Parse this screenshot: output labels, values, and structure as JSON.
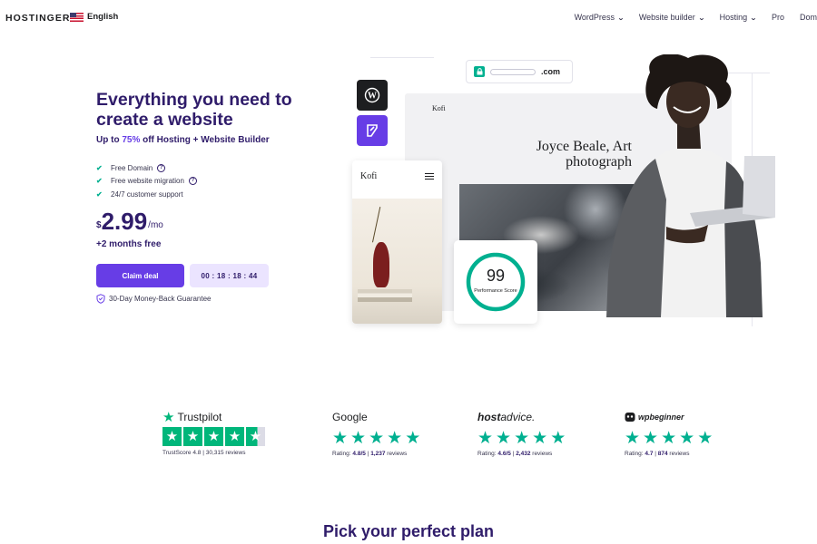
{
  "header": {
    "logo": "HOSTINGER",
    "language": "English",
    "nav": [
      {
        "label": "WordPress",
        "has_dropdown": true
      },
      {
        "label": "Website builder",
        "has_dropdown": true
      },
      {
        "label": "Hosting",
        "has_dropdown": true
      },
      {
        "label": "Pro",
        "has_dropdown": false
      },
      {
        "label": "Dom",
        "has_dropdown": false
      }
    ]
  },
  "hero": {
    "title": "Everything you need to create a website",
    "subtitle_prefix": "Up to ",
    "subtitle_discount": "75%",
    "subtitle_suffix": " off Hosting + Website Builder",
    "features": [
      {
        "label": "Free Domain",
        "help": true
      },
      {
        "label": "Free website migration",
        "help": true
      },
      {
        "label": "24/7 customer support",
        "help": false
      }
    ],
    "price": {
      "currency": "$",
      "amount": "2.99",
      "period": "/mo"
    },
    "bonus": "+2 months free",
    "cta_label": "Claim deal",
    "timer": "00 : 18 : 18 : 44",
    "guarantee": "30-Day Money-Back Guarantee"
  },
  "hero_art": {
    "domain_suffix": ".com",
    "site_name": "Kofi",
    "site_title": "Joyce Beale, Art photograph",
    "phone_site_name": "Kofi",
    "score_value": "99",
    "score_label": "Performance Score",
    "score_fraction": 0.99
  },
  "reviews": [
    {
      "brand": "Trustpilot",
      "meta_prefix": "TrustScore ",
      "rating": "4.8",
      "separator": " | ",
      "count": "30,315",
      "meta_suffix": " reviews",
      "stars": 4.5
    },
    {
      "brand": "Google",
      "meta_prefix": "Rating: ",
      "rating": "4.8/5",
      "separator": " | ",
      "count": "1,237",
      "meta_suffix": " reviews",
      "stars": 5
    },
    {
      "brand_bold": "host",
      "brand_rest": "advice.",
      "meta_prefix": "Rating: ",
      "rating": "4.6/5",
      "separator": " | ",
      "count": "2,432",
      "meta_suffix": " reviews",
      "stars": 5
    },
    {
      "brand": "wpbeginner",
      "meta_prefix": "Rating: ",
      "rating": "4.7",
      "separator": " | ",
      "count": "874",
      "meta_suffix": " reviews",
      "stars": 5
    }
  ],
  "plans": {
    "title": "Pick your perfect plan"
  },
  "colors": {
    "primary": "#673de6",
    "navy": "#2f1c6a",
    "green": "#00b090",
    "trustpilot": "#00b67a",
    "timer_bg": "#ebe4ff"
  }
}
